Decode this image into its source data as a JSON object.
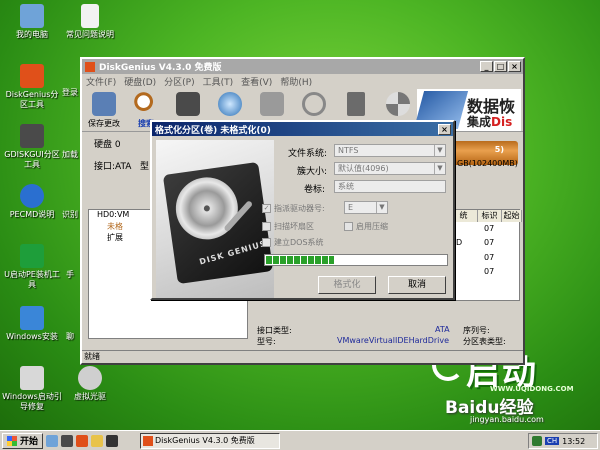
{
  "desktop_icons": [
    {
      "label": "我的电脑",
      "color": "#6fa3d8"
    },
    {
      "label": "常见问题说明",
      "color": "#f2f2f2"
    },
    {
      "label": "DiskGenius分区工具",
      "color": "#e0501a"
    },
    {
      "label": "登录",
      "color": "#dddddd"
    },
    {
      "label": "GDISKGUI分区工具",
      "color": "#4a4a4a"
    },
    {
      "label": "加载",
      "color": "#888888"
    },
    {
      "label": "PECMD说明",
      "color": "#2a6fd0"
    },
    {
      "label": "识别",
      "color": "#888888"
    },
    {
      "label": "U启动PE装机工具",
      "color": "#1e9e3a"
    },
    {
      "label": "手",
      "color": "#888888"
    },
    {
      "label": "Windows安装",
      "color": "#3a86d8"
    },
    {
      "label": "聊",
      "color": "#888888"
    },
    {
      "label": "Windows启动引导修复",
      "color": "#d8d8d8"
    },
    {
      "label": "虚拟光驱",
      "color": "#cfcfcf"
    }
  ],
  "main_window": {
    "title": "DiskGenius V4.3.0 免费版",
    "menu": [
      "文件(F)",
      "硬盘(D)",
      "分区(P)",
      "工具(T)",
      "查看(V)",
      "帮助(H)"
    ],
    "toolbar": [
      {
        "label": "保存更改",
        "icon": "save-icon"
      },
      {
        "label": "搜索",
        "icon": "search-icon"
      },
      {
        "label": "",
        "icon": "backup-icon"
      },
      {
        "label": "",
        "icon": "disk-icon"
      },
      {
        "label": "",
        "icon": "printer-icon"
      },
      {
        "label": "",
        "icon": "delete-icon"
      },
      {
        "label": "",
        "icon": "trash-icon"
      },
      {
        "label": "",
        "icon": "format-icon"
      }
    ],
    "banner": {
      "line1": "数据恢",
      "line2_pre": "集成",
      "line2_red": "Dis"
    },
    "disk_label": "硬盘 0",
    "interface_label": "接口:ATA",
    "model_label": "型",
    "disk_capacity": "GB(102400MB)",
    "badge_5": "5)",
    "tree": [
      {
        "label": "HD0:VM",
        "indent": 0
      },
      {
        "label": "未格",
        "indent": 1
      },
      {
        "label": "扩展",
        "indent": 1
      },
      {
        "label": "",
        "indent": 2
      },
      {
        "label": "",
        "indent": 2
      }
    ],
    "grid_headers": [
      "统",
      "标识",
      "起始"
    ],
    "grid_rows": [
      [
        "",
        "07",
        ""
      ],
      [
        "D",
        "07",
        ""
      ],
      [
        "",
        "07",
        ""
      ],
      [
        "",
        "07",
        ""
      ]
    ],
    "info": {
      "iface_key": "接口类型:",
      "iface_val": "ATA",
      "seq_key": "序列号:",
      "model_key": "型号:",
      "model_val": "VMwareVirtualIDEHardDrive",
      "ptable_key": "分区表类型:"
    },
    "status": "就绪"
  },
  "dialog": {
    "title": "格式化分区(卷) 未格式化(0)",
    "hd_brand": "DISK GENIUS",
    "fs_label": "文件系统:",
    "fs_value": "NTFS",
    "cluster_label": "簇大小:",
    "cluster_value": "默认值(4096)",
    "vol_label": "卷标:",
    "vol_value": "系统",
    "drive_letter_label": "指派驱动器号:",
    "drive_letter_value": "E",
    "scan_bad_label": "扫描坏扇区",
    "compress_label": "启用压缩",
    "dos_label": "建立DOS系统",
    "progress": 0.38,
    "format_btn": "格式化",
    "cancel_btn": "取消"
  },
  "taskbar": {
    "start": "开始",
    "task": "DiskGenius V4.3.0 免费版",
    "ime": "CH",
    "clock": "13:52"
  },
  "watermark": {
    "logo_big": "启动",
    "logo_small": "WWW.UQIDONG.COM",
    "baidu": "Baidu经验",
    "baidu_sub": "jingyan.baidu.com"
  }
}
